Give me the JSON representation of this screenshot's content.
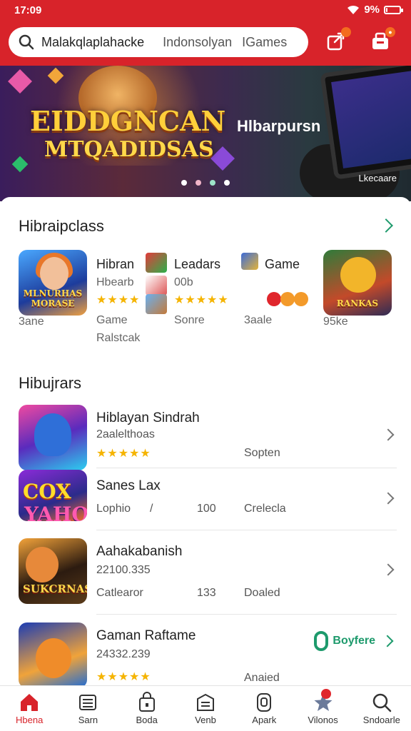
{
  "status_bar": {
    "time": "17:09",
    "battery": "9%",
    "battery_level": 0.09
  },
  "search": {
    "query": "Malakqlaplahacke",
    "tag2": "Indonsolyan",
    "tag3": "IGames"
  },
  "header_actions": [
    {
      "icon": "share-icon"
    },
    {
      "icon": "cart-icon"
    }
  ],
  "banner": {
    "title_line1": "EIDDGNCAN",
    "title_line2": "MTQADIDSAS",
    "subtitle": "Hlbarpursn",
    "corner_text": "Lkecaare",
    "slides": 4,
    "active_slide": 1
  },
  "section1": {
    "title": "Hibraipclass",
    "items": [
      {
        "thumb_text": "MLNURHAS MORASE",
        "caption": "3ane"
      },
      {
        "name": "Hibran",
        "sub1": "Hbearb",
        "stars": "★★★★",
        "caption": "Game",
        "caption2": "Ralstcak"
      },
      {
        "name": "Leadars",
        "sub1": "00b",
        "stars": "★★★★★",
        "caption": "Sonre"
      },
      {
        "name": "Game",
        "caption": "3aale"
      },
      {
        "thumb_text": "RANKAS",
        "caption": "95ke"
      }
    ]
  },
  "section2": {
    "title": "Hibujrars",
    "items": [
      {
        "name": "Hiblayan Sindrah",
        "sub": "2aalelthoas",
        "stars": "★★★★★",
        "meta": "Sopten"
      },
      {
        "name": "Sanes Lax",
        "sub": "Lophio",
        "meta_sep": "/",
        "meta_num": "100",
        "meta": "Crelecla",
        "thumb_l1": "COX",
        "thumb_l2": "YAHO"
      },
      {
        "name": "Aahakabanish",
        "sub": "22100.335",
        "meta_label": "Catlearor",
        "meta_num": "133",
        "meta": "Doaled",
        "thumb_text": "SUKCRNAS"
      },
      {
        "name": "Gaman Raftame",
        "sub": "24332.239",
        "stars": "★★★★★",
        "meta": "Anaied",
        "action": "Boyfere"
      }
    ]
  },
  "bottom_nav": [
    {
      "label": "Hbena",
      "icon": "home-icon",
      "active": true
    },
    {
      "label": "Sarn",
      "icon": "list-icon"
    },
    {
      "label": "Boda",
      "icon": "bag-icon"
    },
    {
      "label": "Venb",
      "icon": "inbox-icon"
    },
    {
      "label": "Apark",
      "icon": "app-icon"
    },
    {
      "label": "Vilonos",
      "icon": "star-icon"
    },
    {
      "label": "Sndoarle",
      "icon": "search-icon"
    }
  ],
  "colors": {
    "brand": "#d8232a",
    "accent": "#1d9a6c",
    "star": "#f5b400"
  }
}
